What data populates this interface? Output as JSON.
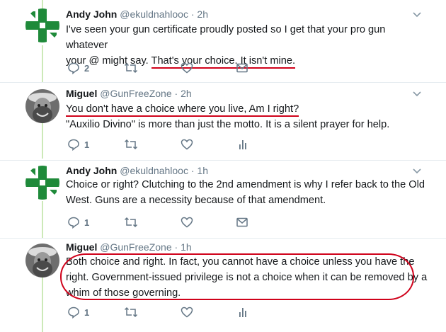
{
  "colors": {
    "accent_red": "#d0021b",
    "thread_line": "#cce9b8",
    "muted": "#657786"
  },
  "tweets": [
    {
      "name": "Andy John",
      "handle": "@ekuldnahlooc",
      "time": "2h",
      "avatar_icon": "green-cross-flag-icon",
      "line1": "I've seen your gun certificate proudly posted so I get that your pro gun whatever",
      "line2_plain": "your @ might say. ",
      "line2_underlined": "That's your choice. It isn't mine.",
      "reply_count": "2",
      "retweet_count": "",
      "like_count": "",
      "extra_icon": "message-icon"
    },
    {
      "name": "Miguel",
      "handle": "@GunFreeZone",
      "time": "2h",
      "avatar_icon": "bearded-man-photo",
      "line1_underlined": "You don't have a choice where you live, Am I right?",
      "line2": "\"Auxilio Divino\" is more than just the motto. It is a silent prayer for help.",
      "reply_count": "1",
      "extra_icon": "analytics-icon"
    },
    {
      "name": "Andy John",
      "handle": "@ekuldnahlooc",
      "time": "1h",
      "avatar_icon": "green-cross-flag-icon",
      "line1": "Choice or right? Clutching to the 2nd amendment is why I refer back to the Old",
      "line2": "West. Guns are a necessity because of that amendment.",
      "reply_count": "1",
      "extra_icon": "message-icon"
    },
    {
      "name": "Miguel",
      "handle": "@GunFreeZone",
      "time": "1h",
      "avatar_icon": "bearded-man-photo",
      "line1": "Both choice and right. In fact, you cannot have a choice unless you have the",
      "line2": "right. Government-issued privilege is not a choice when it can be removed by a",
      "line3": "whim of those governing.",
      "reply_count": "1",
      "extra_icon": "analytics-icon"
    }
  ]
}
